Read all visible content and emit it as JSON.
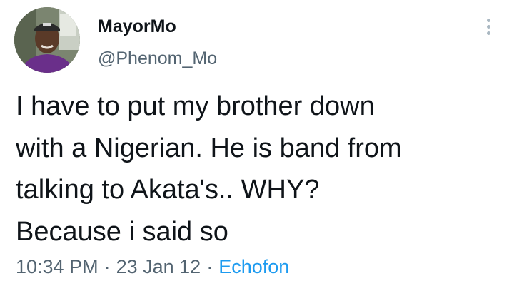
{
  "author": {
    "display_name": "MayorMo",
    "handle": "@Phenom_Mo"
  },
  "tweet": {
    "text": "I have to put my brother down\nwith a Nigerian. He is band from\ntalking to Akata's.. WHY?\nBecause i said so"
  },
  "meta": {
    "time": "10:34 PM",
    "separator": "·",
    "date": "23 Jan 12",
    "source": "Echofon"
  },
  "icons": {
    "more": "more-vertical-icon"
  },
  "colors": {
    "text": "#0f1419",
    "secondary": "#536471",
    "link": "#1d9bf0",
    "background": "#ffffff"
  }
}
